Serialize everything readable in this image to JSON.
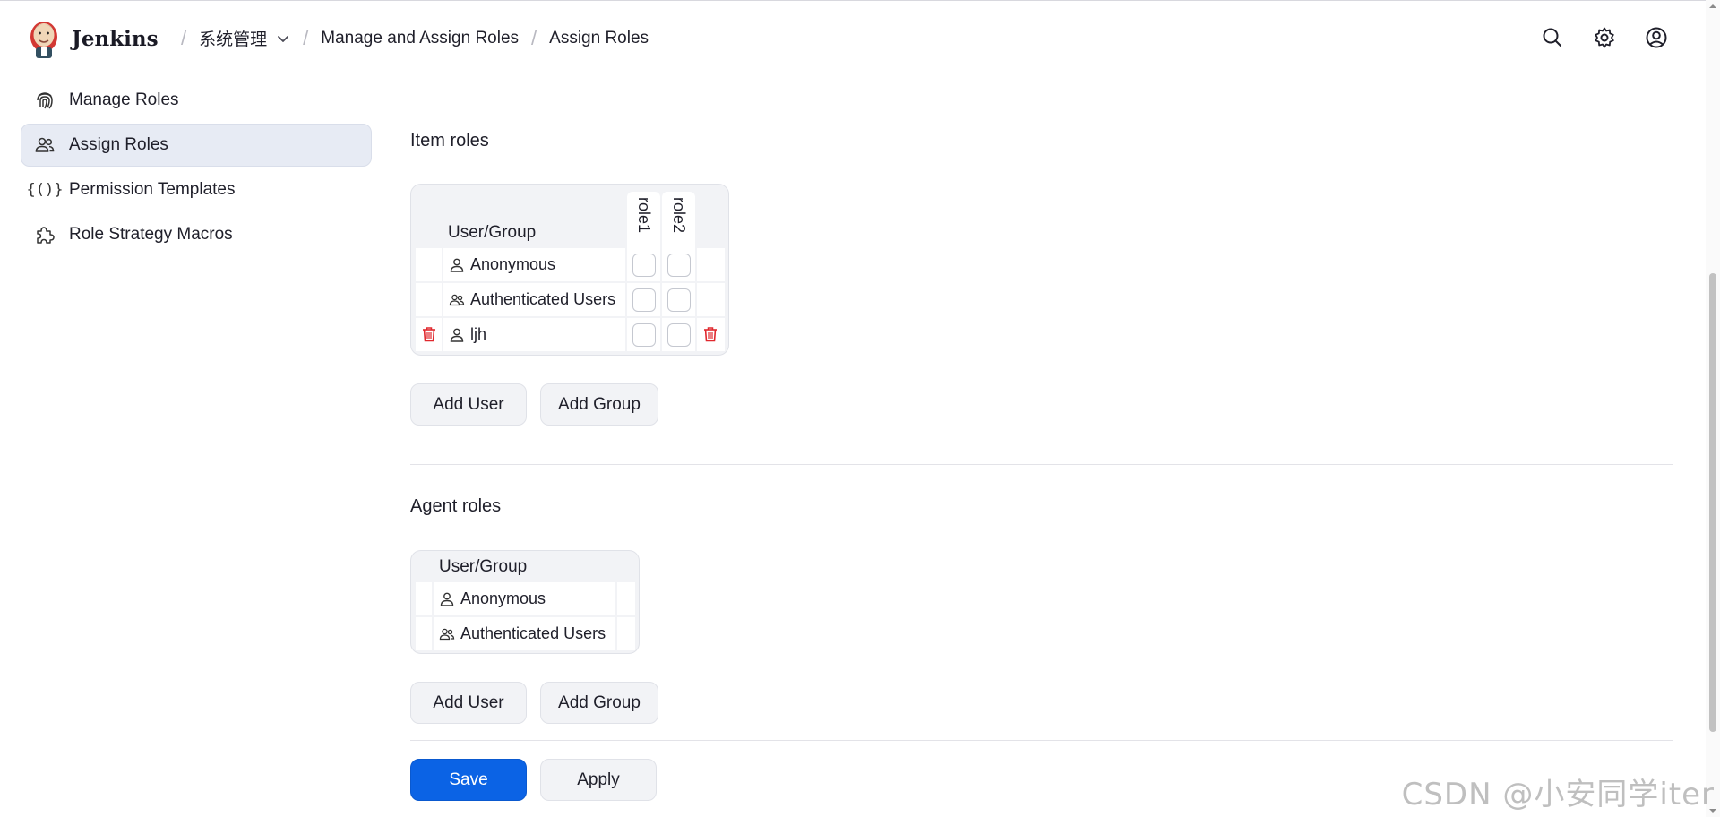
{
  "header": {
    "brand": "Jenkins",
    "breadcrumbs": [
      "系统管理",
      "Manage and Assign Roles",
      "Assign Roles"
    ]
  },
  "sidebar": {
    "items": [
      {
        "label": "Manage Roles",
        "icon": "fingerprint-icon"
      },
      {
        "label": "Assign Roles",
        "icon": "people-icon",
        "active": true
      },
      {
        "label": "Permission Templates",
        "icon": "braces-icon"
      },
      {
        "label": "Role Strategy Macros",
        "icon": "puzzle-icon"
      }
    ]
  },
  "item_roles": {
    "title": "Item roles",
    "column_header": "User/Group",
    "roles": [
      "role1",
      "role2"
    ],
    "rows": [
      {
        "name": "Anonymous",
        "type": "user",
        "checks": [
          false,
          false
        ]
      },
      {
        "name": "Authenticated Users",
        "type": "group",
        "checks": [
          false,
          false
        ]
      },
      {
        "name": "ljh",
        "type": "user",
        "checks": [
          false,
          false
        ],
        "deletable": true
      }
    ],
    "add_user": "Add User",
    "add_group": "Add Group"
  },
  "agent_roles": {
    "title": "Agent roles",
    "column_header": "User/Group",
    "rows": [
      {
        "name": "Anonymous",
        "type": "user"
      },
      {
        "name": "Authenticated Users",
        "type": "group"
      }
    ],
    "add_user": "Add User",
    "add_group": "Add Group"
  },
  "footer": {
    "save": "Save",
    "apply": "Apply"
  },
  "watermark": "CSDN @小安同学iter",
  "colors": {
    "primary": "#0b63e5",
    "danger": "#e0282e",
    "active_bg": "#e7ebf4"
  }
}
